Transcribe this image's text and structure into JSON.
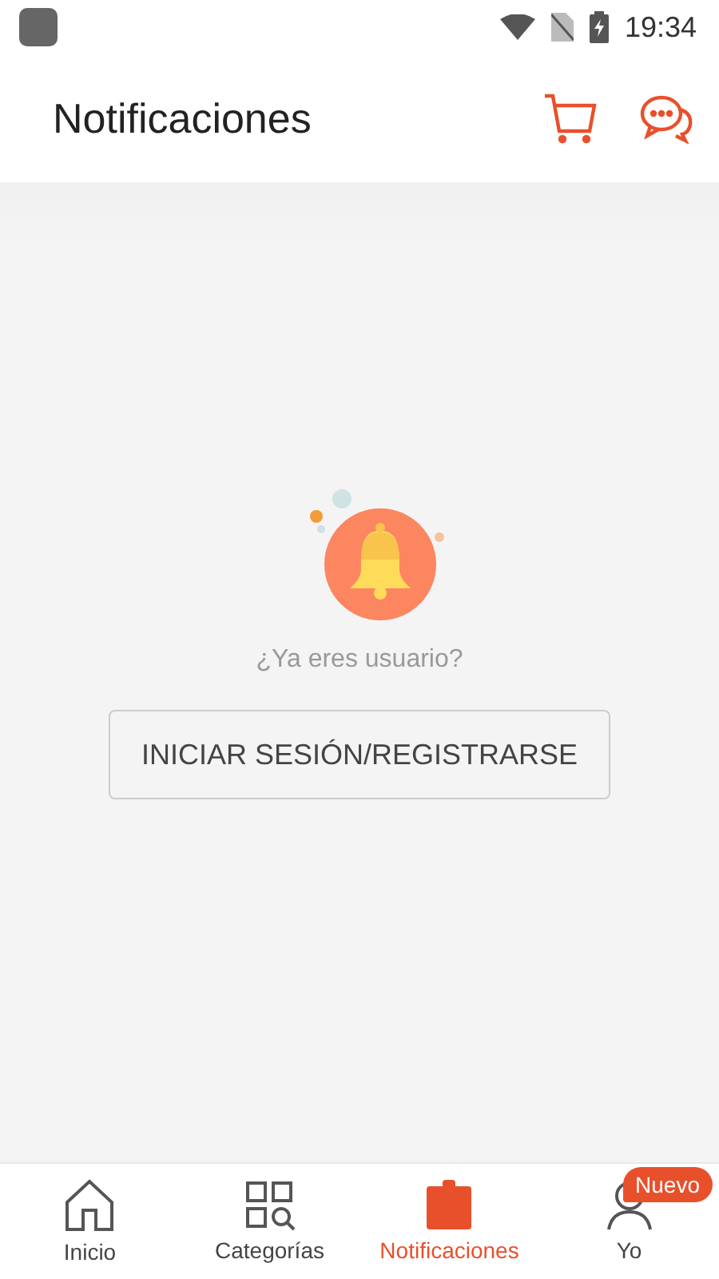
{
  "status_bar": {
    "time": "19:34"
  },
  "header": {
    "title": "Notificaciones"
  },
  "empty_state": {
    "prompt": "¿Ya eres usuario?",
    "button": "INICIAR SESIÓN/REGISTRARSE"
  },
  "bottom_nav": [
    {
      "kind": "home",
      "label": "Inicio",
      "selected": false
    },
    {
      "kind": "categories",
      "label": "Categorías",
      "selected": false
    },
    {
      "kind": "notifications",
      "label": "Notificaciones",
      "selected": true
    },
    {
      "kind": "profile",
      "label": "Yo",
      "selected": false,
      "badge": "Nuevo"
    }
  ]
}
